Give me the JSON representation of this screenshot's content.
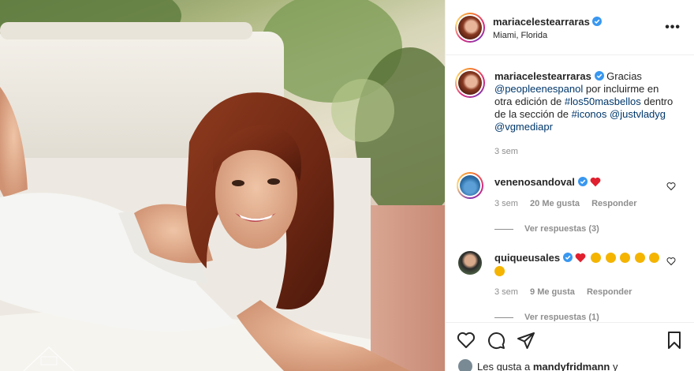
{
  "post": {
    "author": "mariacelestearraras",
    "location": "Miami, Florida",
    "more_label": "•••",
    "caption": {
      "author": "mariacelestearraras",
      "word_gracias": "Gracias",
      "mention_people": "@peopleenespanol",
      "text_1": "por incluirme en otra edición de",
      "hashtag_1": "#los50masbellos",
      "text_2": "dentro de la sección de",
      "hashtag_2": "#iconos",
      "mention_2": "@justvladyg",
      "mention_3": "@vgmediapr",
      "time": "3 sem"
    }
  },
  "comments": [
    {
      "user": "venenosandoval",
      "text_suffix": "",
      "time": "3 sem",
      "likes": "20 Me gusta",
      "reply": "Responder",
      "view_replies": "Ver respuestas (3)"
    },
    {
      "user": "quiqueusales",
      "text_suffix": "",
      "time": "3 sem",
      "likes": "9 Me gusta",
      "reply": "Responder",
      "view_replies": "Ver respuestas (1)"
    }
  ],
  "footer": {
    "likes_prefix": "Les gusta a",
    "likes_user": "mandyfridmann",
    "likes_suffix": "y"
  },
  "colors": {
    "text": "#262626",
    "link": "#00376b",
    "muted": "#8e8e8e",
    "verified": "#3897f0",
    "heart": "#ed4956",
    "border": "#efefef"
  },
  "icons": {
    "verified": "verified-badge-icon",
    "heart": "heart-icon",
    "comment": "comment-icon",
    "share": "share-icon",
    "save": "bookmark-icon",
    "more": "more-options-icon",
    "clap": "clapping-hands-emoji"
  }
}
